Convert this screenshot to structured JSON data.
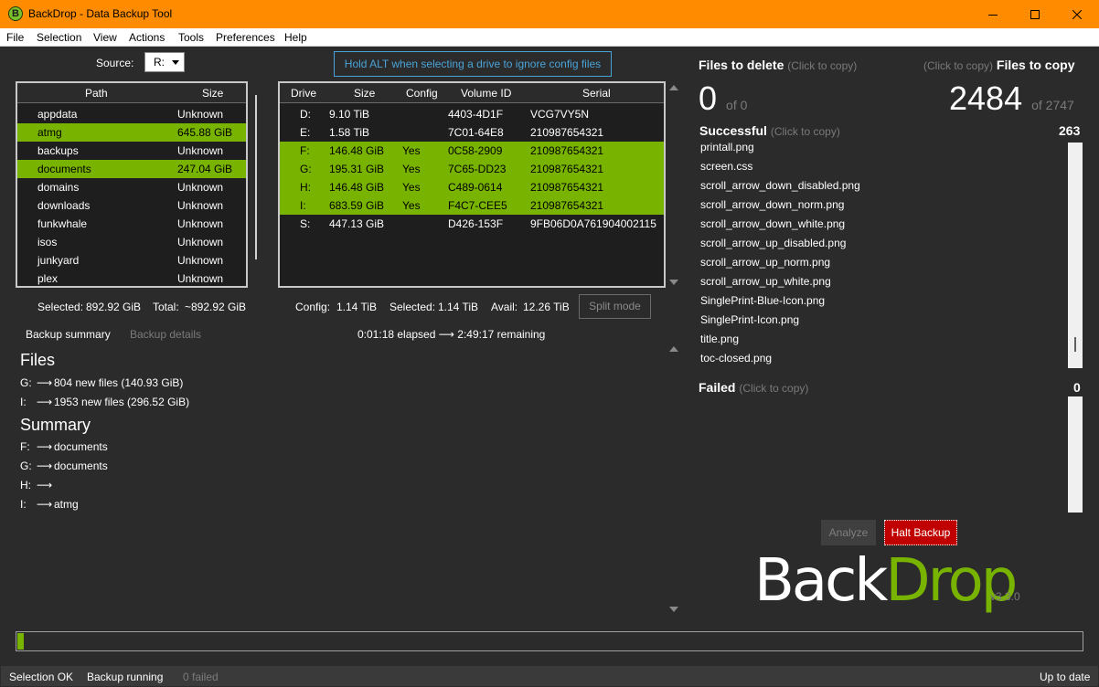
{
  "window": {
    "title": "BackDrop - Data Backup Tool",
    "app_icon_letter": "B",
    "accent_color": "#ff8c00"
  },
  "menu": {
    "file": "File",
    "selection": "Selection",
    "view": "View",
    "actions": "Actions",
    "tools": "Tools",
    "preferences": "Preferences",
    "help": "Help"
  },
  "source": {
    "label": "Source:",
    "value": "R:"
  },
  "hint": "Hold ALT when selecting a drive to ignore config files",
  "path_table": {
    "headers": [
      "Path",
      "Size"
    ],
    "rows": [
      {
        "path": "appdata",
        "size": "Unknown",
        "selected": false
      },
      {
        "path": "atmg",
        "size": "645.88 GiB",
        "selected": true
      },
      {
        "path": "backups",
        "size": "Unknown",
        "selected": false
      },
      {
        "path": "documents",
        "size": "247.04 GiB",
        "selected": true
      },
      {
        "path": "domains",
        "size": "Unknown",
        "selected": false
      },
      {
        "path": "downloads",
        "size": "Unknown",
        "selected": false
      },
      {
        "path": "funkwhale",
        "size": "Unknown",
        "selected": false
      },
      {
        "path": "isos",
        "size": "Unknown",
        "selected": false
      },
      {
        "path": "junkyard",
        "size": "Unknown",
        "selected": false
      },
      {
        "path": "plex",
        "size": "Unknown",
        "selected": false
      }
    ],
    "selected_label": "Selected:",
    "selected_value": "892.92 GiB",
    "total_label": "Total:",
    "total_value": "~892.92 GiB"
  },
  "drive_table": {
    "headers": [
      "Drive",
      "Size",
      "Config",
      "Volume ID",
      "Serial"
    ],
    "rows": [
      {
        "drive": "D:",
        "size": "9.10 TiB",
        "config": "",
        "volume": "4403-4D1F",
        "serial": "VCG7VY5N",
        "selected": false
      },
      {
        "drive": "E:",
        "size": "1.58 TiB",
        "config": "",
        "volume": "7C01-64E8",
        "serial": "210987654321",
        "selected": false
      },
      {
        "drive": "F:",
        "size": "146.48 GiB",
        "config": "Yes",
        "volume": "0C58-2909",
        "serial": "210987654321",
        "selected": true
      },
      {
        "drive": "G:",
        "size": "195.31 GiB",
        "config": "Yes",
        "volume": "7C65-DD23",
        "serial": "210987654321",
        "selected": true
      },
      {
        "drive": "H:",
        "size": "146.48 GiB",
        "config": "Yes",
        "volume": "C489-0614",
        "serial": "210987654321",
        "selected": true
      },
      {
        "drive": "I:",
        "size": "683.59 GiB",
        "config": "Yes",
        "volume": "F4C7-CEE5",
        "serial": "210987654321",
        "selected": true
      },
      {
        "drive": "S:",
        "size": "447.13 GiB",
        "config": "",
        "volume": "D426-153F",
        "serial": "9FB06D0A761904002115",
        "selected": false
      }
    ],
    "config_label": "Config:",
    "config_value": "1.14 TiB",
    "selected_label": "Selected:",
    "selected_value": "1.14 TiB",
    "avail_label": "Avail:",
    "avail_value": "12.26 TiB",
    "split_mode": "Split mode"
  },
  "tabs": {
    "summary": "Backup summary",
    "details": "Backup details"
  },
  "elapsed": "0:01:18 elapsed ⟶ 2:49:17 remaining",
  "summary": {
    "files_heading": "Files",
    "files_lines": [
      {
        "drive": "G:",
        "text": "804 new files (140.93 GiB)"
      },
      {
        "drive": "I:",
        "text": "1953 new files (296.52 GiB)"
      }
    ],
    "summary_heading": "Summary",
    "summary_lines": [
      {
        "drive": "F:",
        "text": "documents"
      },
      {
        "drive": "G:",
        "text": "documents"
      },
      {
        "drive": "H:",
        "text": ""
      },
      {
        "drive": "I:",
        "text": "atmg"
      }
    ],
    "arrow": "⟶"
  },
  "right": {
    "delete_title": "Files to delete",
    "click_to_copy": "(Click to copy)",
    "copy_title": "Files to copy",
    "delete_count": "0",
    "delete_total": "of 0",
    "copy_count": "2484",
    "copy_total": "of 2747",
    "successful_title": "Successful",
    "successful_count": "263",
    "successful_files": [
      "printall.png",
      "screen.css",
      "scroll_arrow_down_disabled.png",
      "scroll_arrow_down_norm.png",
      "scroll_arrow_down_white.png",
      "scroll_arrow_up_disabled.png",
      "scroll_arrow_up_norm.png",
      "scroll_arrow_up_white.png",
      "SinglePrint-Blue-Icon.png",
      "SinglePrint-Icon.png",
      "title.png",
      "toc-closed.png"
    ],
    "failed_title": "Failed",
    "failed_count": "0",
    "analyze": "Analyze",
    "halt": "Halt Backup"
  },
  "logo": {
    "back": "Back",
    "drop": "Drop",
    "version": "v3.3.0",
    "color": "#78b300"
  },
  "progress": {
    "fraction": 0.006
  },
  "status": {
    "selection": "Selection OK",
    "backup": "Backup running",
    "failed": "0 failed",
    "update": "Up to date"
  }
}
